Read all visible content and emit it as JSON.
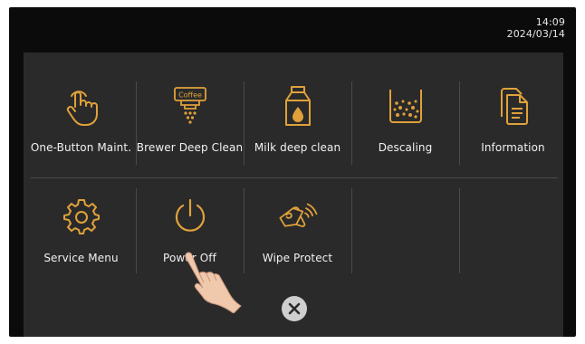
{
  "status": {
    "time": "14:09",
    "date": "2024/03/14"
  },
  "menu": {
    "items": [
      {
        "label": "One-Button Maint.",
        "icon": "touch-icon"
      },
      {
        "label": "Brewer Deep Clean",
        "icon": "brewer-icon",
        "icon_text": "Coffee"
      },
      {
        "label": "Milk deep clean",
        "icon": "milk-carton-icon"
      },
      {
        "label": "Descaling",
        "icon": "descaling-icon"
      },
      {
        "label": "Information",
        "icon": "documents-icon"
      },
      {
        "label": "Service Menu",
        "icon": "gear-icon"
      },
      {
        "label": "Power Off",
        "icon": "power-icon"
      },
      {
        "label": "Wipe Protect",
        "icon": "wipe-icon"
      }
    ]
  },
  "colors": {
    "accent": "#e0a13a",
    "panel": "#2a2a2a",
    "screen": "#0b0b0b",
    "close_button": "#cfcfcf"
  }
}
